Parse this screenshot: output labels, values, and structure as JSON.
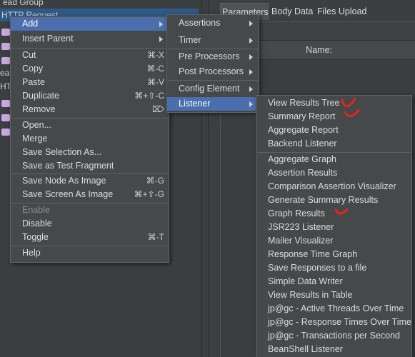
{
  "tree": {
    "thread_group_fragment": "ead Group",
    "http_request_fragment": "HTTP Request",
    "fragment_read": "ead",
    "fragment_ht": "HT"
  },
  "right_panel": {
    "tabs": [
      "Parameters",
      "Body Data",
      "Files Upload"
    ],
    "name_header": "Name:"
  },
  "context_menu": {
    "items": [
      {
        "label": "Add",
        "submenu": true,
        "selected": true
      },
      {
        "label": "Insert Parent",
        "submenu": true
      },
      {
        "label": "Cut",
        "accel": "⌘-X"
      },
      {
        "label": "Copy",
        "accel": "⌘-C"
      },
      {
        "label": "Paste",
        "accel": "⌘-V"
      },
      {
        "label": "Duplicate",
        "accel": "⌘+⇧-C"
      },
      {
        "label": "Remove",
        "accel": "⌦"
      },
      {
        "label": "Open..."
      },
      {
        "label": "Merge"
      },
      {
        "label": "Save Selection As..."
      },
      {
        "label": "Save as Test Fragment"
      },
      {
        "label": "Save Node As Image",
        "accel": "⌘-G"
      },
      {
        "label": "Save Screen As Image",
        "accel": "⌘+⇧-G"
      },
      {
        "label": "Enable",
        "disabled": true
      },
      {
        "label": "Disable"
      },
      {
        "label": "Toggle",
        "accel": "⌘-T"
      },
      {
        "label": "Help"
      }
    ]
  },
  "add_submenu": {
    "items": [
      {
        "label": "Assertions"
      },
      {
        "label": "Timer"
      },
      {
        "label": "Pre Processors"
      },
      {
        "label": "Post Processors"
      },
      {
        "label": "Config Element"
      },
      {
        "label": "Listener",
        "selected": true
      }
    ]
  },
  "listener_submenu": {
    "items": [
      {
        "label": "View Results Tree",
        "checked": true
      },
      {
        "label": "Summary Report",
        "checked": true
      },
      {
        "label": "Aggregate Report"
      },
      {
        "label": "Backend Listener"
      },
      {
        "label": "Aggregate Graph"
      },
      {
        "label": "Assertion Results"
      },
      {
        "label": "Comparison Assertion Visualizer"
      },
      {
        "label": "Generate Summary Results"
      },
      {
        "label": "Graph Results",
        "checked": true
      },
      {
        "label": "JSR223 Listener"
      },
      {
        "label": "Mailer Visualizer"
      },
      {
        "label": "Response Time Graph"
      },
      {
        "label": "Save Responses to a file"
      },
      {
        "label": "Simple Data Writer"
      },
      {
        "label": "View Results in Table"
      },
      {
        "label": "jp@gc - Active Threads Over Time"
      },
      {
        "label": "jp@gc - Response Times Over Time"
      },
      {
        "label": "jp@gc - Transactions per Second"
      },
      {
        "label": "BeanShell Listener"
      }
    ]
  },
  "colors": {
    "menu_bg": "#45494a",
    "selection": "#4b6eaf",
    "tree_selection": "#2d5a87",
    "annotation_check": "#e8231b"
  }
}
